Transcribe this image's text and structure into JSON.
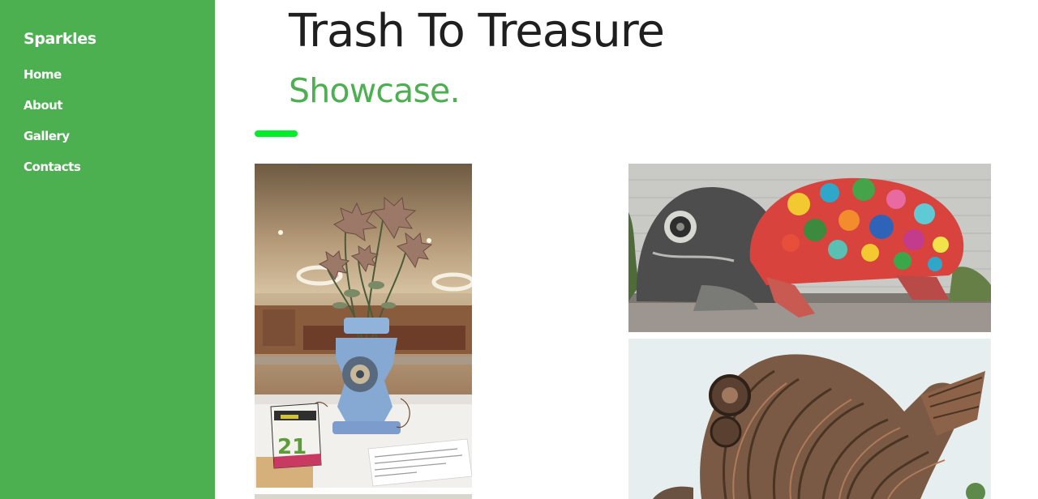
{
  "sidebar": {
    "brand": "Sparkles",
    "nav": [
      {
        "label": "Home"
      },
      {
        "label": "About"
      },
      {
        "label": "Gallery"
      },
      {
        "label": "Contacts"
      }
    ]
  },
  "main": {
    "title": "Trash To Treasure",
    "subtitle": "Showcase."
  },
  "gallery": {
    "images": [
      {
        "name": "vase-sculpture-photo",
        "table_card_number": "21"
      },
      {
        "name": "turtle-sculpture-photo"
      },
      {
        "name": "fish-sculpture-photo"
      },
      {
        "name": "partial-photo"
      }
    ]
  },
  "colors": {
    "sidebar_bg": "#4caf50",
    "accent_bar": "#00ee2a",
    "title": "#1f1f1f",
    "subtitle": "#4caf50"
  }
}
